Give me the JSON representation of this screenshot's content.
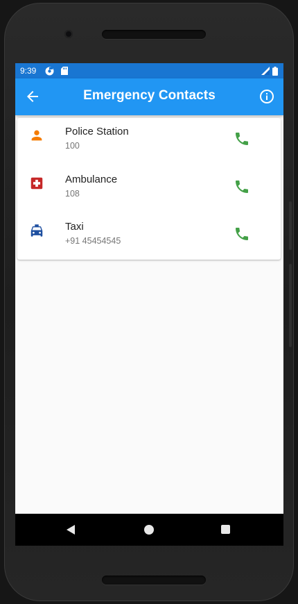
{
  "status_bar": {
    "time": "9:39",
    "icons": [
      "gear-notification-icon",
      "sd-card-icon",
      "signal-icon",
      "battery-icon"
    ]
  },
  "app_bar": {
    "title": "Emergency Contacts",
    "back_icon": "arrow-back-icon",
    "info_icon": "info-outline-icon",
    "background": "#2196f3"
  },
  "contacts": [
    {
      "name": "Police Station",
      "number": "100",
      "icon": "person-icon",
      "icon_color": "#f57c00"
    },
    {
      "name": "Ambulance",
      "number": "108",
      "icon": "medical-cross-icon",
      "icon_color": "#c62828"
    },
    {
      "name": "Taxi",
      "number": "+91 45454545",
      "icon": "taxi-icon",
      "icon_color": "#1e4fa0"
    }
  ],
  "call_icon": {
    "name": "phone-icon",
    "color": "#43a047"
  },
  "nav_bar": {
    "buttons": [
      "nav-back-icon",
      "nav-home-icon",
      "nav-recents-icon"
    ]
  }
}
